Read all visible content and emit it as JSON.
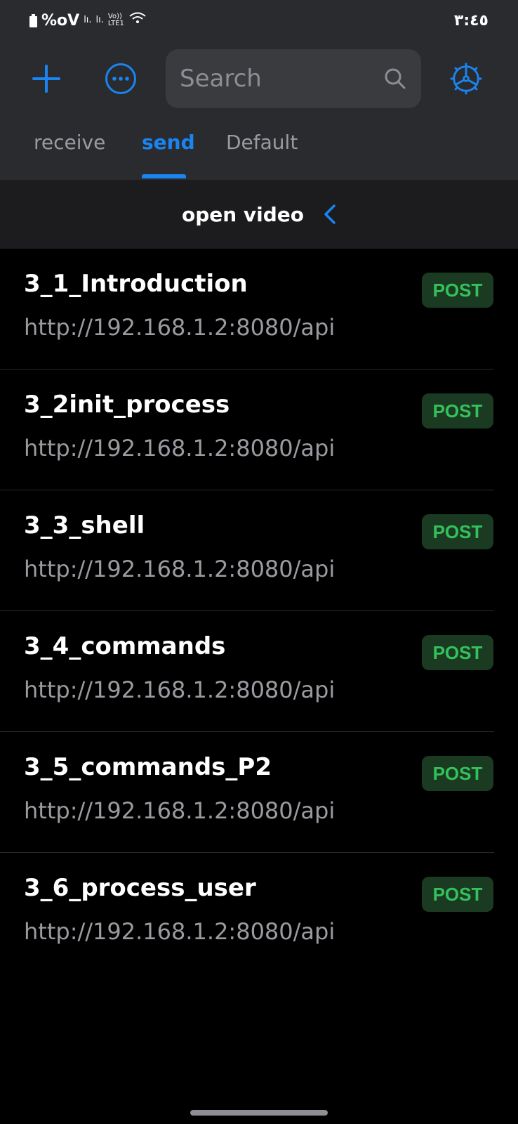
{
  "status_bar": {
    "battery_text": "%oV",
    "signal1": "lı.",
    "signal2": "lı.",
    "volte_top": "Vo))",
    "volte_bottom": "LTE1",
    "time": "٣:٤٥"
  },
  "toolbar": {
    "add_icon": "plus-icon",
    "more_icon": "more-icon",
    "settings_icon": "gear-icon"
  },
  "search": {
    "value": "",
    "placeholder": "Search"
  },
  "tabs": [
    {
      "label": "receive",
      "active": false
    },
    {
      "label": "send",
      "active": true
    },
    {
      "label": "Default",
      "active": false
    }
  ],
  "folder": {
    "title": "open video"
  },
  "requests": [
    {
      "name": "3_1_Introduction",
      "url": "http://192.168.1.2:8080/api",
      "method": "POST"
    },
    {
      "name": "3_2init_process",
      "url": "http://192.168.1.2:8080/api",
      "method": "POST"
    },
    {
      "name": "3_3_shell",
      "url": "http://192.168.1.2:8080/api",
      "method": "POST"
    },
    {
      "name": "3_4_commands",
      "url": "http://192.168.1.2:8080/api",
      "method": "POST"
    },
    {
      "name": "3_5_commands_P2",
      "url": "http://192.168.1.2:8080/api",
      "method": "POST"
    },
    {
      "name": "3_6_process_user",
      "url": "http://192.168.1.2:8080/api",
      "method": "POST"
    }
  ],
  "colors": {
    "accent": "#1a84f0",
    "header_bg": "#2a2b2f",
    "folder_bg": "#1c1c1e",
    "badge_bg": "#1b3a22",
    "badge_text": "#33c25a"
  }
}
